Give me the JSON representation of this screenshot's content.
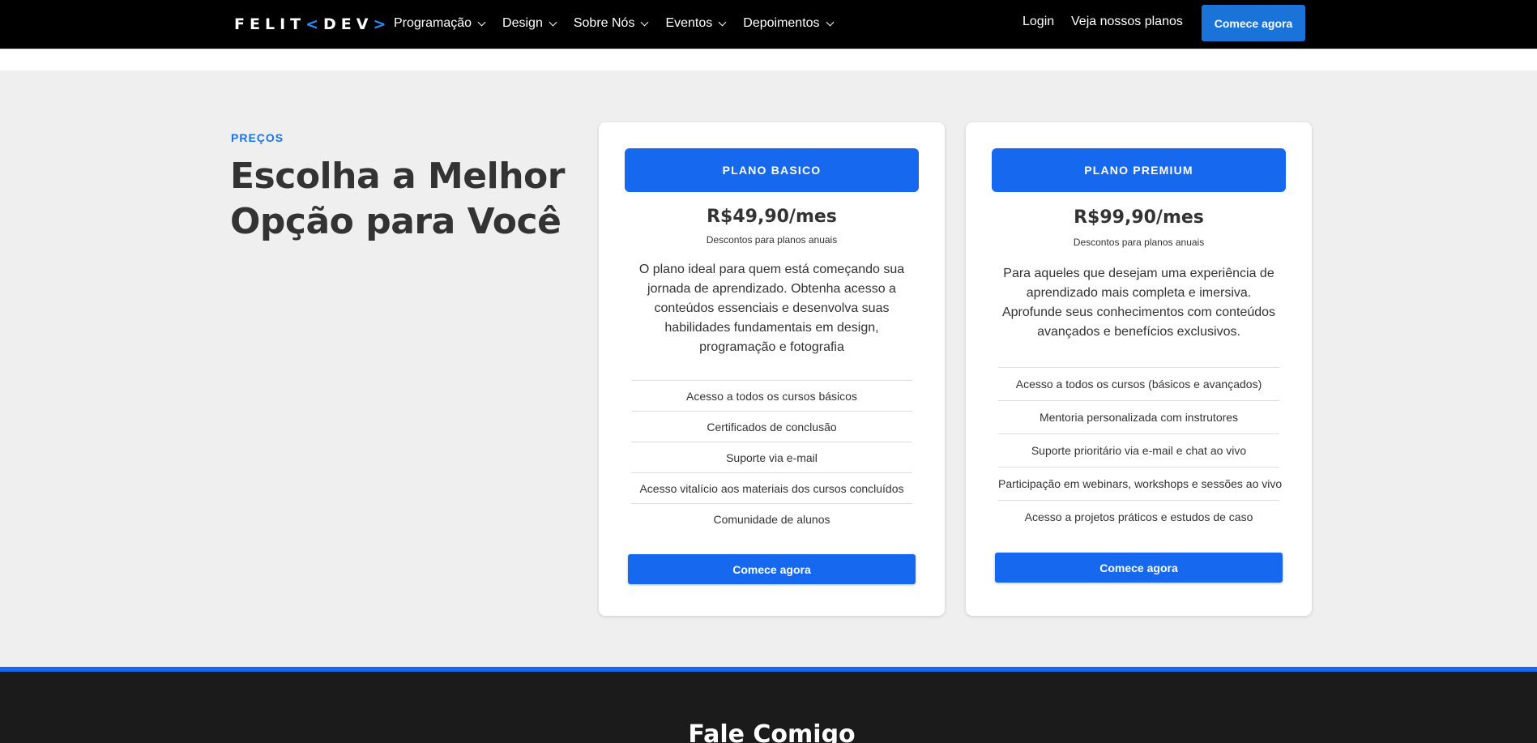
{
  "navbar": {
    "logo_left": "FELIT",
    "logo_open": "<",
    "logo_right": "DEV",
    "logo_close": ">",
    "menu": [
      {
        "label": "Programação"
      },
      {
        "label": "Design"
      },
      {
        "label": "Sobre Nós"
      },
      {
        "label": "Eventos"
      },
      {
        "label": "Depoimentos"
      }
    ],
    "login": "Login",
    "plans_link": "Veja nossos planos",
    "cta": "Comece agora"
  },
  "pricing": {
    "eyebrow": "PREÇOS",
    "heading": "Escolha a Melhor Opção para Você",
    "plans": [
      {
        "name": "PLANO BASICO",
        "price": "R$49,90/mes",
        "discount": "Descontos para planos anuais",
        "description": "O plano ideal para quem está começando sua jornada de aprendizado. Obtenha acesso a conteúdos essenciais e desenvolva suas habilidades fundamentais em design, programação e fotografia",
        "features": [
          "Acesso a todos os cursos básicos",
          "Certificados de conclusão",
          "Suporte via e-mail",
          "Acesso vitalício aos materiais dos cursos concluídos",
          "Comunidade de alunos"
        ],
        "cta": "Comece agora"
      },
      {
        "name": "PLANO PREMIUM",
        "price": "R$99,90/mes",
        "discount": "Descontos para planos anuais",
        "description": "Para aqueles que desejam uma experiência de aprendizado mais completa e imersiva. Aprofunde seus conhecimentos com conteúdos avançados e benefícios exclusivos.",
        "features": [
          "Acesso a todos os cursos (básicos e avançados)",
          "Mentoria personalizada com instrutores",
          "Suporte prioritário via e-mail e chat ao vivo",
          "Participação em webinars, workshops e sessões ao vivo",
          "Acesso a projetos práticos e estudos de caso"
        ],
        "cta": "Comece agora"
      }
    ]
  },
  "contact": {
    "title": "Fale Comigo"
  },
  "colors": {
    "accent": "#1668ef",
    "navbar_bg": "#000000",
    "section_bg": "#efefef",
    "footer_bg": "#1b1b1b"
  }
}
